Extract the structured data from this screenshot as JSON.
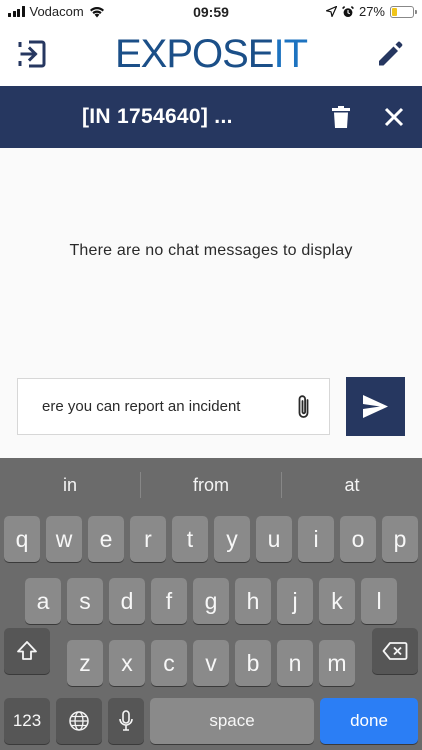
{
  "status_bar": {
    "carrier": "Vodacom",
    "time": "09:59",
    "battery": "27%",
    "battery_level": 0.27
  },
  "header": {
    "logo_part_a": "EX",
    "logo_part_b": "POSE",
    "logo_part_c": "IT",
    "exit_icon": "exit-icon",
    "edit_icon": "pencil-icon",
    "logo_color_dark": "#1b4f88",
    "logo_color_light": "#1d73c0"
  },
  "title_bar": {
    "title": "[IN 1754640] ...",
    "background": "#263760",
    "delete_icon": "trash-icon",
    "close_icon": "close-icon"
  },
  "chat": {
    "empty_message": "There are no chat messages to display",
    "input_value": "ere you can report an incident",
    "attach_icon": "paperclip-icon",
    "send_icon": "send-icon"
  },
  "keyboard": {
    "suggestions": [
      "in",
      "from",
      "at"
    ],
    "row1": [
      "q",
      "w",
      "e",
      "r",
      "t",
      "y",
      "u",
      "i",
      "o",
      "p"
    ],
    "row2": [
      "a",
      "s",
      "d",
      "f",
      "g",
      "h",
      "j",
      "k",
      "l"
    ],
    "row3": [
      "z",
      "x",
      "c",
      "v",
      "b",
      "n",
      "m"
    ],
    "numbers_label": "123",
    "space_label": "space",
    "done_label": "done",
    "shift_icon": "shift-icon",
    "backspace_icon": "backspace-icon",
    "globe_icon": "globe-icon",
    "mic_icon": "microphone-icon",
    "done_color": "#2b7ef5"
  }
}
